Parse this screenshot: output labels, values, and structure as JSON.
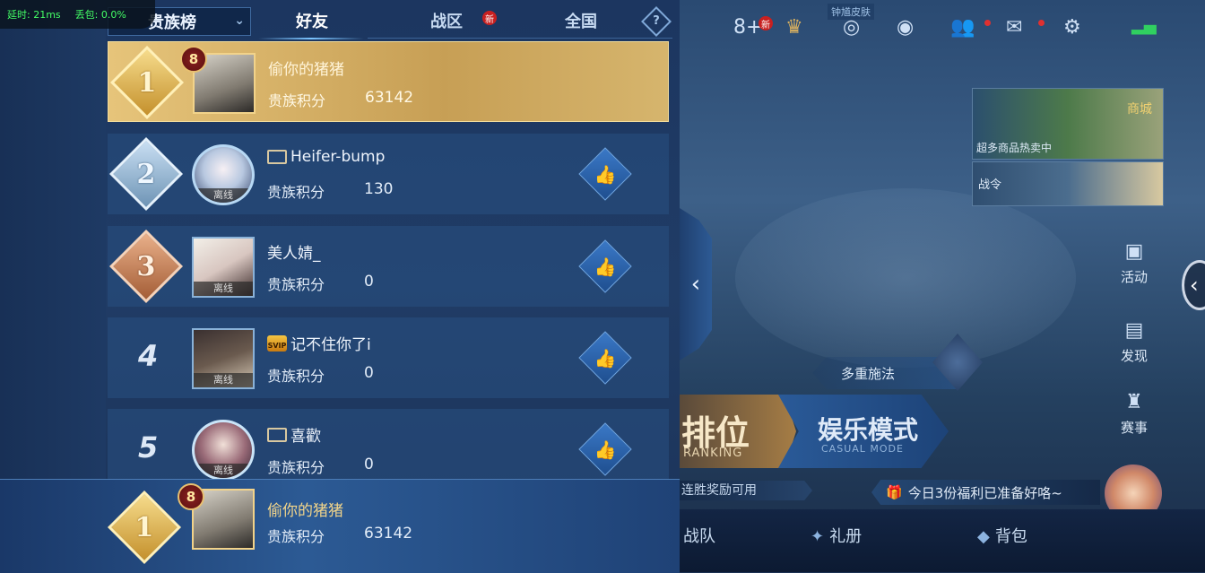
{
  "status": {
    "latency": "延时: 21ms",
    "loss": "丢包: 0.0%"
  },
  "panel": {
    "dropdown_label": "贵族榜",
    "tabs": [
      "好友",
      "战区",
      "全国"
    ],
    "new_badge": "新",
    "help_label": "?"
  },
  "rows": [
    {
      "rank": "1",
      "level": "8",
      "name": "偷你的猪猪",
      "score_label": "贵族积分",
      "score": "63142",
      "offline": ""
    },
    {
      "rank": "2",
      "level": "",
      "name": "Heifer-bump",
      "score_label": "贵族积分",
      "score": "130",
      "offline": "离线"
    },
    {
      "rank": "3",
      "level": "",
      "name": "美人婧_",
      "score_label": "贵族积分",
      "score": "0",
      "offline": "离线"
    },
    {
      "rank": "4",
      "level": "",
      "name": "记不住你了i",
      "score_label": "贵族积分",
      "score": "0",
      "offline": "离线",
      "svip": "SVIP"
    },
    {
      "rank": "5",
      "level": "",
      "name": "喜歡",
      "score_label": "贵族积分",
      "score": "0",
      "offline": "离线"
    }
  ],
  "mine": {
    "rank": "1",
    "level": "8",
    "name": "偷你的猪猪",
    "score_label": "贵族积分",
    "score": "63142"
  },
  "game": {
    "topbar": {
      "count": "8",
      "new_badge": "新",
      "skin_tag": "钟馗皮肤"
    },
    "shop": {
      "subtitle": "超多商品热卖中",
      "mall": "商城"
    },
    "battle_pass": "战令",
    "side": [
      "活动",
      "发现",
      "赛事"
    ],
    "multi_cast": "多重施法",
    "ranked": {
      "big": "排位",
      "small": "RANKING"
    },
    "casual": {
      "big": "娱乐模式",
      "small": "CASUAL MODE"
    },
    "win_reward": "连胜奖励可用",
    "gift_bar": "今日3份福利已准备好咯~",
    "bottom": [
      "战队",
      "礼册",
      "背包"
    ]
  }
}
